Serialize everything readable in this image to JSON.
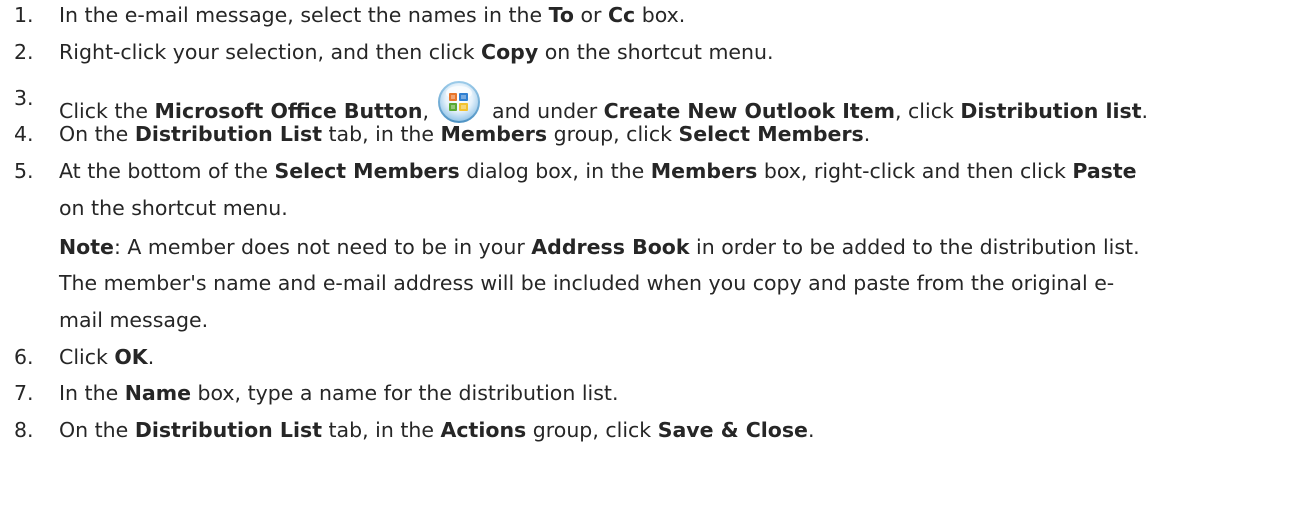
{
  "steps": [
    {
      "number": "1.",
      "parts": [
        "In the e-mail message, select the names in the ",
        "To",
        " or ",
        "Cc",
        " box."
      ]
    },
    {
      "number": "2.",
      "parts": [
        "Right-click your selection, and then click ",
        "Copy",
        " on the shortcut menu."
      ]
    },
    {
      "number": "3.",
      "parts": [
        "Click the ",
        "Microsoft Office Button",
        ", ",
        " and under ",
        "Create New Outlook Item",
        ", click ",
        "Distribution list",
        "."
      ],
      "icon": "microsoft-office-button-icon"
    },
    {
      "number": "4.",
      "parts": [
        "On the ",
        "Distribution List",
        " tab, in the ",
        "Members",
        " group, click ",
        "Select Members",
        "."
      ]
    },
    {
      "number": "5.",
      "parts": [
        "At the bottom of the ",
        "Select Members",
        " dialog box, in the ",
        "Members",
        " box, right-click and then click ",
        "Paste"
      ],
      "line2": "on the shortcut menu.",
      "note": {
        "label": "Note",
        "line1_parts": [
          ":  A member does not need to be in your ",
          "Address Book",
          " in order to be added to the distribution list."
        ],
        "line2": "The member's name and e-mail address will be included when you copy and paste from the original e-",
        "line3": "mail message."
      }
    },
    {
      "number": "6.",
      "parts": [
        "Click ",
        "OK",
        "."
      ]
    },
    {
      "number": "7.",
      "parts": [
        "In the ",
        "Name",
        " box, type a name for the distribution list."
      ]
    },
    {
      "number": "8.",
      "parts": [
        "On the ",
        "Distribution List",
        " tab, in the ",
        "Actions",
        " group, click ",
        "Save & Close",
        "."
      ]
    }
  ]
}
